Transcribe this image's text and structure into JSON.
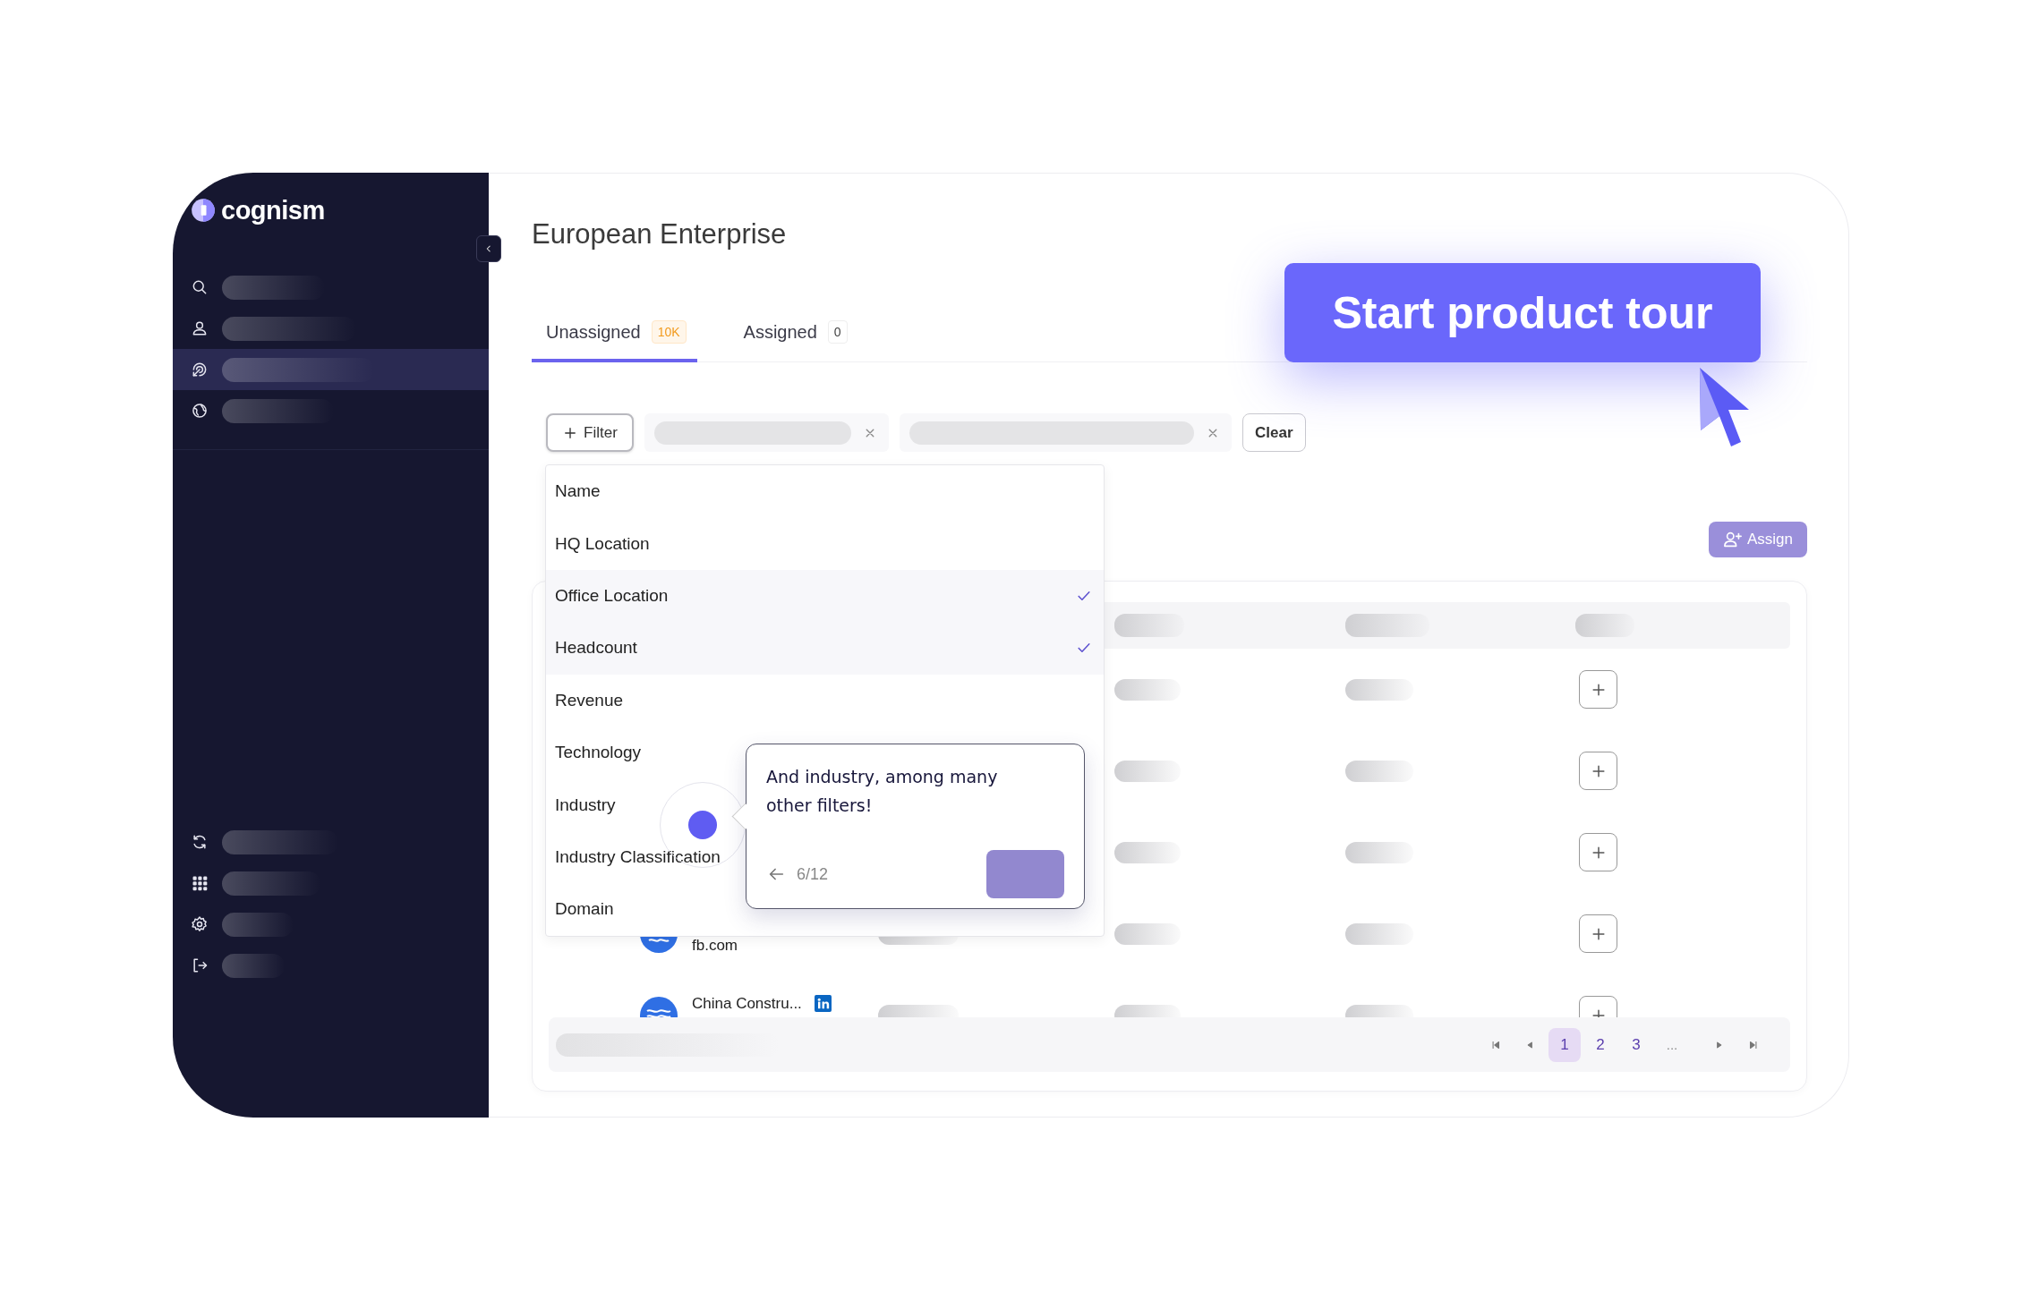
{
  "sidebar": {
    "logo": "cognism",
    "nav_items": [
      {
        "selected": false
      },
      {
        "selected": false
      },
      {
        "selected": true
      },
      {
        "selected": false
      }
    ]
  },
  "page_title": "European Enterprise",
  "tabs": [
    {
      "label": "Unassigned",
      "count": "10K",
      "selected": true
    },
    {
      "label": "Assigned",
      "count": "0",
      "selected": false
    }
  ],
  "filter_bar": {
    "filter_button": "Filter",
    "clear_button": "Clear"
  },
  "filter_menu": [
    {
      "label": "Name",
      "checked": false
    },
    {
      "label": "HQ Location",
      "checked": false
    },
    {
      "label": "Office Location",
      "checked": true
    },
    {
      "label": "Headcount",
      "checked": true
    },
    {
      "label": "Revenue",
      "checked": false
    },
    {
      "label": "Technology",
      "checked": false
    },
    {
      "label": "Industry",
      "checked": false
    },
    {
      "label": "Industry Classification",
      "checked": false
    },
    {
      "label": "Domain",
      "checked": false
    }
  ],
  "tour_tooltip": {
    "text": "And industry, among many other filters!",
    "step": "6/12"
  },
  "tour_button": "Start product tour",
  "assign_button": "Assign",
  "table": {
    "rows": [
      {},
      {},
      {},
      {
        "domain": "fb.com"
      },
      {
        "name": "China Constru..."
      }
    ]
  },
  "pagination": {
    "pages": [
      {
        "label": "1",
        "selected": true
      },
      {
        "label": "2",
        "selected": false
      },
      {
        "label": "3",
        "selected": false
      }
    ],
    "ellipsis": "..."
  }
}
